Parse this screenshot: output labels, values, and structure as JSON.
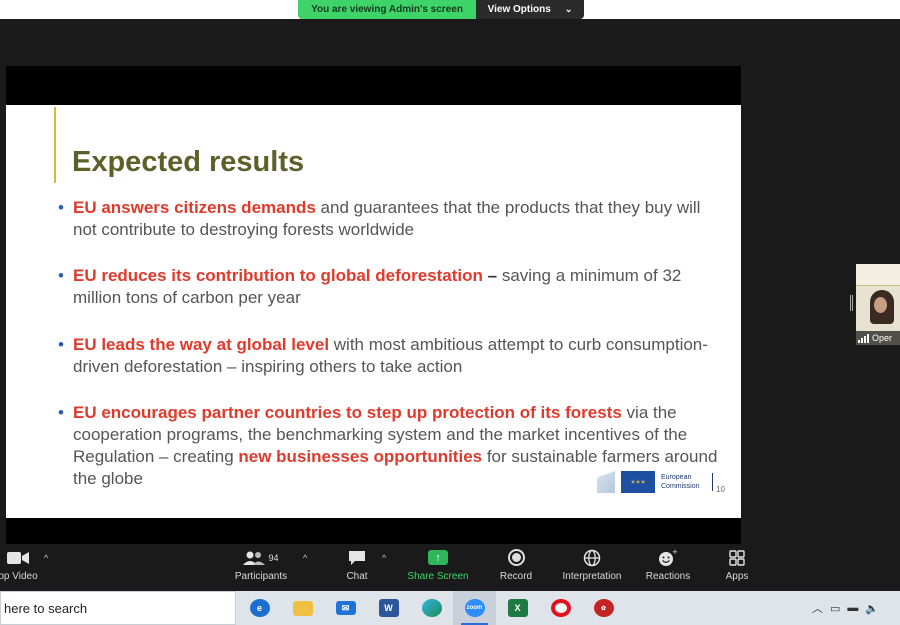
{
  "banner": {
    "viewing_label": "You are viewing Admin's screen",
    "view_options_label": "View Options"
  },
  "slide": {
    "title": "Expected results",
    "bullets": [
      {
        "highlight": "EU answers citizens demands",
        "text": " and guarantees that the products that they buy will not contribute to destroying forests worldwide"
      },
      {
        "highlight": "EU reduces its contribution to global deforestation",
        "dash": " – ",
        "text": "saving a minimum of 32 million tons of carbon per year"
      },
      {
        "highlight": "EU leads the way at global level",
        "text": " with most ambitious attempt to curb consumption-driven deforestation – inspiring others to take action"
      },
      {
        "highlight": "EU encourages partner countries to step up protection of its forests",
        "text": " via the cooperation programs, the benchmarking system and the market incentives of the Regulation – creating ",
        "highlight2": "new businesses opportunities",
        "text2": " for sustainable farmers around the globe"
      }
    ],
    "logo_text_line1": "European",
    "logo_text_line2": "Commission",
    "page_number": "10"
  },
  "thumbnail": {
    "caption": "Oper"
  },
  "toolbar": {
    "stop_video": "op Video",
    "participants": "Participants",
    "participants_count": "94",
    "chat": "Chat",
    "share_screen": "Share Screen",
    "record": "Record",
    "interpretation": "Interpretation",
    "reactions": "Reactions",
    "apps": "Apps"
  },
  "taskbar": {
    "search_placeholder": "here to search",
    "zoom_label": "zoom",
    "apps": [
      "edge-legacy",
      "file-explorer",
      "mail",
      "word",
      "edge",
      "zoom",
      "excel",
      "opera",
      "app"
    ]
  },
  "colors": {
    "highlight_red": "#e03a2c",
    "title_olive": "#5d6129",
    "share_green": "#3fd46a"
  }
}
